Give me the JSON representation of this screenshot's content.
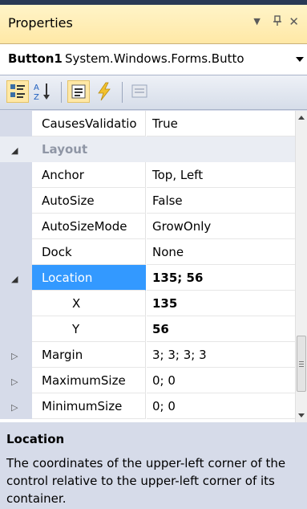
{
  "panel": {
    "title": "Properties",
    "pin_label": "▾ 1 ✕"
  },
  "object_selector": {
    "name": "Button1",
    "type": "System.Windows.Forms.Butto"
  },
  "toolbar": {
    "tools": [
      "categorized-icon",
      "alphabetical-icon",
      "properties-icon",
      "events-icon",
      "property-pages-icon"
    ]
  },
  "grid": {
    "rows": [
      {
        "kind": "property",
        "name": "CausesValidatio",
        "value": "True",
        "bold": false
      },
      {
        "kind": "category",
        "name": "Layout",
        "expander": "◢"
      },
      {
        "kind": "property",
        "name": "Anchor",
        "value": "Top, Left",
        "bold": false
      },
      {
        "kind": "property",
        "name": "AutoSize",
        "value": "False",
        "bold": false
      },
      {
        "kind": "property",
        "name": "AutoSizeMode",
        "value": "GrowOnly",
        "bold": false
      },
      {
        "kind": "property",
        "name": "Dock",
        "value": "None",
        "bold": false
      },
      {
        "kind": "property",
        "name": "Location",
        "value": "135; 56",
        "bold": true,
        "selected": true,
        "expander": "◢"
      },
      {
        "kind": "sub",
        "name": "X",
        "value": "135",
        "bold": true
      },
      {
        "kind": "sub",
        "name": "Y",
        "value": "56",
        "bold": true
      },
      {
        "kind": "property",
        "name": "Margin",
        "value": "3; 3; 3; 3",
        "bold": false,
        "expander": "▷"
      },
      {
        "kind": "property",
        "name": "MaximumSize",
        "value": "0; 0",
        "bold": false,
        "expander": "▷"
      },
      {
        "kind": "property",
        "name": "MinimumSize",
        "value": "0; 0",
        "bold": false,
        "expander": "▷"
      }
    ]
  },
  "description": {
    "title": "Location",
    "text": "The coordinates of the upper-left corner of the control relative to the upper-left corner of its container."
  },
  "colors": {
    "selection": "#3399ff",
    "titlebar": "#ffe8a6",
    "chrome": "#d6dbe9"
  }
}
